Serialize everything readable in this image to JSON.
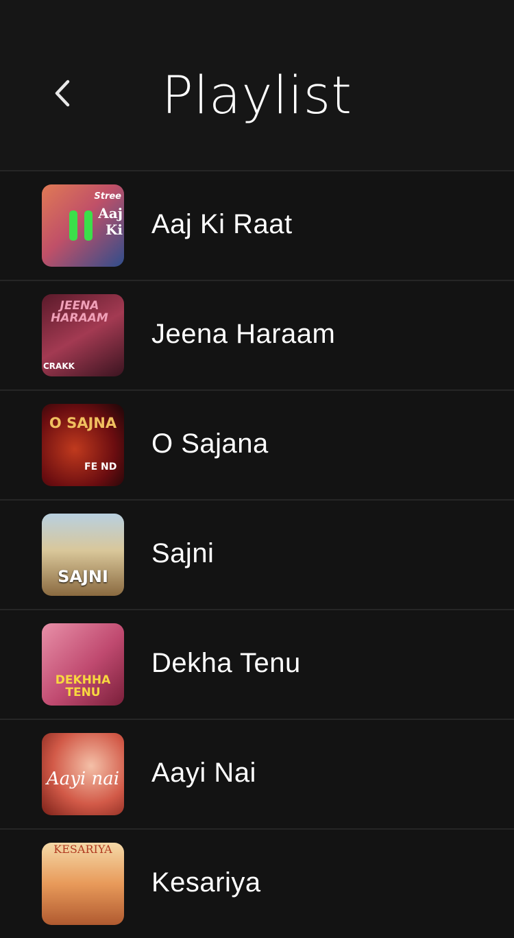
{
  "header": {
    "title": "Playlist",
    "back_icon": "chevron-left-icon"
  },
  "playlist": [
    {
      "title": "Aaj Ki Raat",
      "cover_text": "Aaj Ki",
      "cover_text2": "Stree",
      "playing": true,
      "cover_colors": [
        "#d9755a",
        "#3a5fa0"
      ]
    },
    {
      "title": "Jeena Haraam",
      "cover_text": "JEENA HARAAM",
      "cover_text2": "CRAKK",
      "playing": false,
      "cover_colors": [
        "#7a2035",
        "#c9607a"
      ]
    },
    {
      "title": "O Sajana",
      "cover_text": "O SAJNA",
      "cover_text2": "FE ND",
      "playing": false,
      "cover_colors": [
        "#6b0d10",
        "#b8321a"
      ]
    },
    {
      "title": "Sajni",
      "cover_text": "SAJNI",
      "playing": false,
      "cover_colors": [
        "#d9c79a",
        "#8a9aa8"
      ]
    },
    {
      "title": "Dekha Tenu",
      "cover_text": "DEKHHA TENU",
      "playing": false,
      "cover_colors": [
        "#c9507a",
        "#e8a0a8"
      ]
    },
    {
      "title": "Aayi Nai",
      "cover_text": "Aayi nai",
      "playing": false,
      "cover_colors": [
        "#c94a3a",
        "#f0b0a0"
      ]
    },
    {
      "title": "Kesariya",
      "cover_text": "KESARIYA",
      "playing": false,
      "cover_colors": [
        "#e89a5a",
        "#f4c98a"
      ]
    }
  ],
  "accent_color": "#3be04a"
}
